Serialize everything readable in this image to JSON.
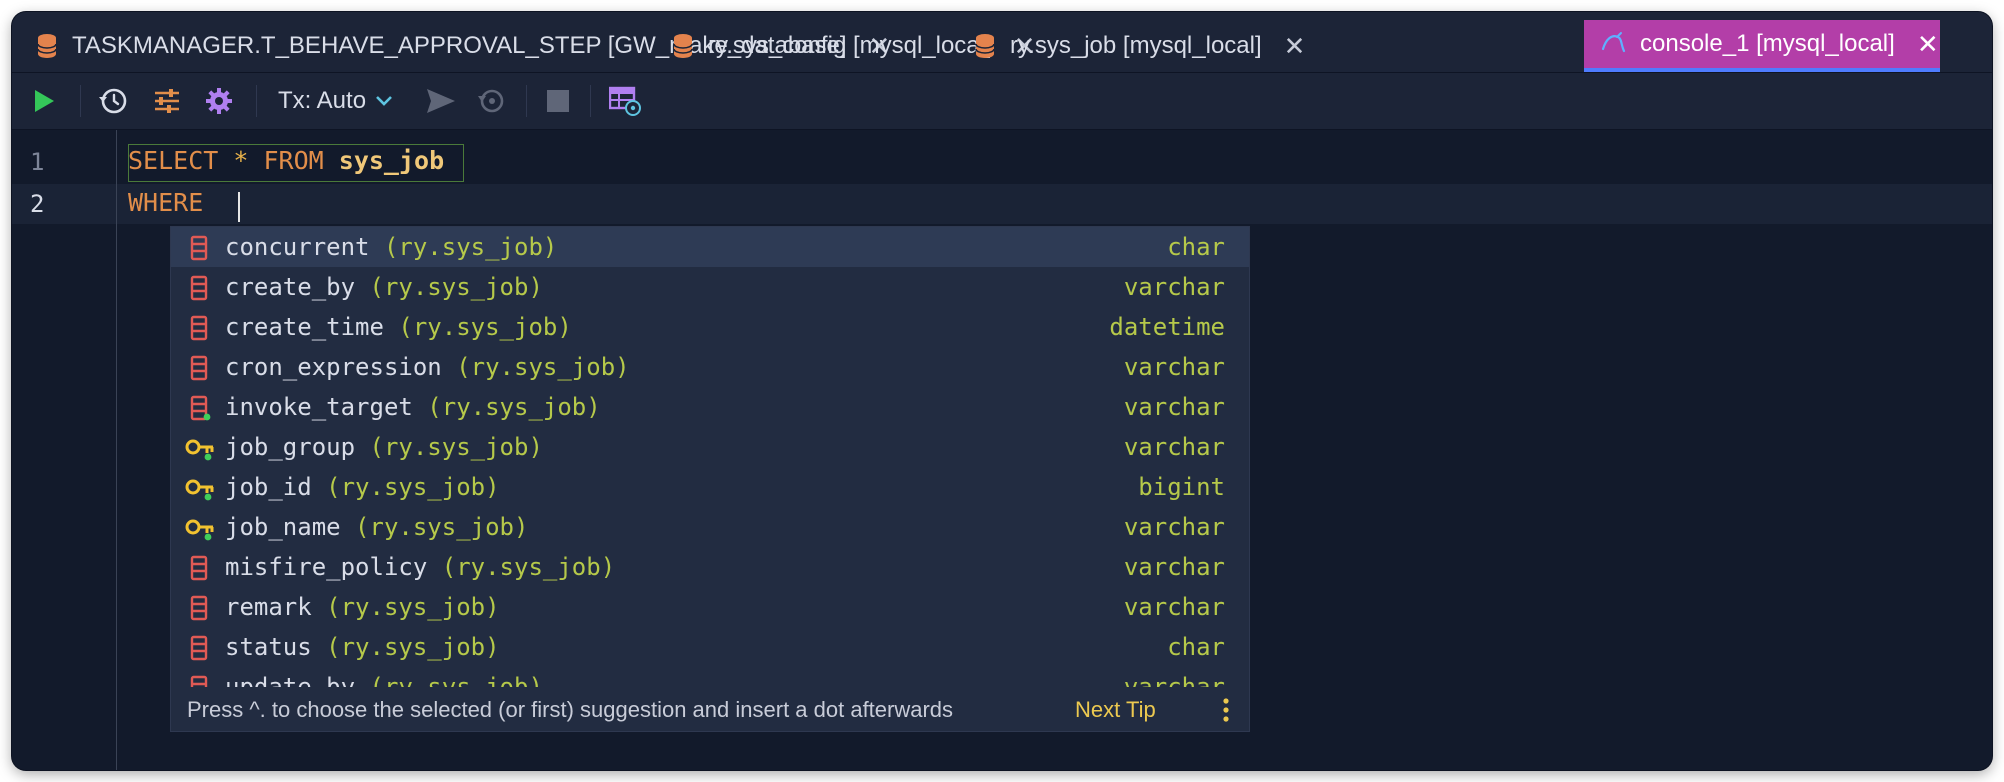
{
  "tabs": [
    {
      "label": "TASKMANAGER.T_BEHAVE_APPROVAL_STEP [GW_make_database]",
      "active": false,
      "icon": "database-icon"
    },
    {
      "label": "ry.sys_config [mysql_local]",
      "active": false,
      "icon": "database-icon"
    },
    {
      "label": "ry.sys_job [mysql_local]",
      "active": false,
      "icon": "database-icon"
    },
    {
      "label": "console_1 [mysql_local]",
      "active": true,
      "icon": "mysql-console-icon"
    }
  ],
  "tab_close_glyph": "✕",
  "toolbar": {
    "tx_label": "Tx: Auto",
    "icons": [
      "run-icon",
      "history-icon",
      "settings-sliders-icon",
      "gear-icon",
      "tx-dropdown-icon",
      "submit-icon",
      "rollback-icon",
      "stop-icon",
      "output-table-icon"
    ]
  },
  "editor": {
    "line_numbers": [
      "1",
      "2"
    ],
    "line1": {
      "kw1": "SELECT",
      "star": "*",
      "kw2": "FROM",
      "table": "sys_job"
    },
    "line2": {
      "kw": "WHERE"
    }
  },
  "completion": {
    "items": [
      {
        "name": "concurrent",
        "source": "(ry.sys_job)",
        "type": "char",
        "icon": "column-icon"
      },
      {
        "name": "create_by",
        "source": "(ry.sys_job)",
        "type": "varchar",
        "icon": "column-icon"
      },
      {
        "name": "create_time",
        "source": "(ry.sys_job)",
        "type": "datetime",
        "icon": "column-icon"
      },
      {
        "name": "cron_expression",
        "source": "(ry.sys_job)",
        "type": "varchar",
        "icon": "column-icon"
      },
      {
        "name": "invoke_target",
        "source": "(ry.sys_job)",
        "type": "varchar",
        "icon": "column-notnull-icon"
      },
      {
        "name": "job_group",
        "source": "(ry.sys_job)",
        "type": "varchar",
        "icon": "primary-key-icon"
      },
      {
        "name": "job_id",
        "source": "(ry.sys_job)",
        "type": "bigint",
        "icon": "primary-key-icon"
      },
      {
        "name": "job_name",
        "source": "(ry.sys_job)",
        "type": "varchar",
        "icon": "primary-key-icon"
      },
      {
        "name": "misfire_policy",
        "source": "(ry.sys_job)",
        "type": "varchar",
        "icon": "column-icon"
      },
      {
        "name": "remark",
        "source": "(ry.sys_job)",
        "type": "varchar",
        "icon": "column-icon"
      },
      {
        "name": "status",
        "source": "(ry.sys_job)",
        "type": "char",
        "icon": "column-icon"
      },
      {
        "name": "update_by",
        "source": "(ry.sys_job)",
        "type": "varchar",
        "icon": "column-icon"
      }
    ],
    "footer_hint": "Press ^. to choose the selected (or first) suggestion and insert a dot afterwards",
    "footer_tip": "Next Tip"
  },
  "colors": {
    "active_tab": "#b33ea8",
    "keyword": "#e28e4a",
    "type": "#b6c94a",
    "key_icon": "#f2c230",
    "column_icon": "#e05a55",
    "run": "#34c759",
    "gear": "#b07ff0"
  }
}
